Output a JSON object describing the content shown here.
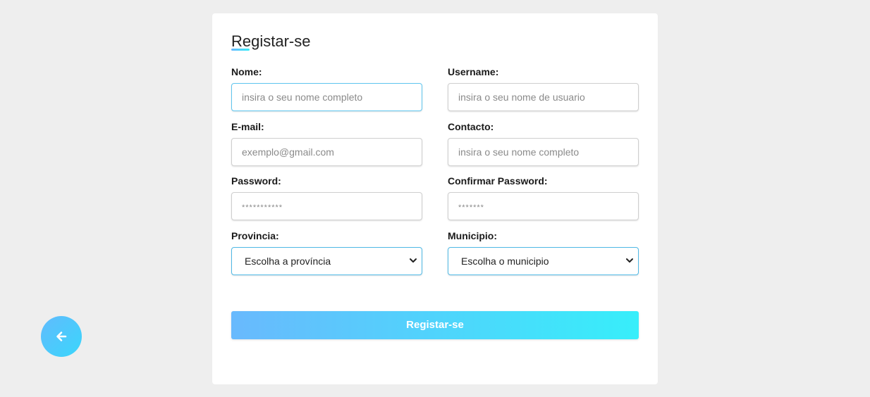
{
  "form": {
    "title": "Registar-se",
    "fields": {
      "nome": {
        "label": "Nome:",
        "placeholder": "insira o seu nome completo"
      },
      "username": {
        "label": "Username:",
        "placeholder": "insira o seu nome de usuario"
      },
      "email": {
        "label": "E-mail:",
        "placeholder": "exemplo@gmail.com"
      },
      "contacto": {
        "label": "Contacto:",
        "placeholder": "insira o seu nome completo"
      },
      "password": {
        "label": "Password:",
        "placeholder": "***********"
      },
      "confirm_password": {
        "label": "Confirmar Password:",
        "placeholder": "*******"
      },
      "provincia": {
        "label": "Provincia:",
        "value": "Escolha a província"
      },
      "municipio": {
        "label": "Municipio:",
        "value": "Escolha o municipio"
      }
    },
    "submit_label": "Registar-se"
  },
  "back_button": {
    "icon": "arrow-left-icon"
  },
  "colors": {
    "background": "#eeeeee",
    "card": "#ffffff",
    "gradient_start": "#69b9fd",
    "gradient_end": "#37eefa",
    "focus_border": "#5fc6ef"
  }
}
